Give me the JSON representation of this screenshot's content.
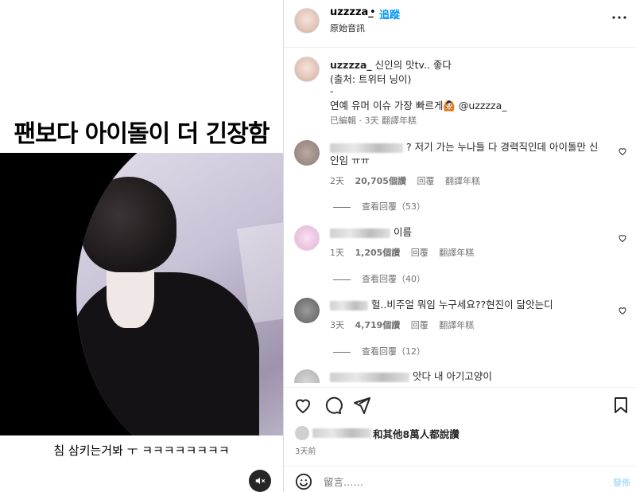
{
  "media": {
    "caption_top": "팬보다 아이돌이 더 긴장함",
    "caption_bottom": "침 삼키는거봐 ㅜ ㅋㅋㅋㅋㅋㅋㅋㅋ",
    "mute_icon": "speaker-muted-icon"
  },
  "header": {
    "username": "uzzzza_",
    "dot": "•",
    "follow_label": "追蹤",
    "audio_label": "原始音訊",
    "more_icon": "more-horizontal-icon"
  },
  "caption": {
    "username": "uzzzza_",
    "line1": "신인의 맛tv.. 좋다",
    "line2": "(출처: 트위터 닝이)",
    "line3": "-",
    "line4": "연예 유머 이슈 가장 빠르게🙆🏻 @uzzzza_",
    "meta": "已編輯 · 3天    翻譯年糕"
  },
  "comments": [
    {
      "text": "? 저기 가는 누나들 다 경력직인데 아이돌만 신인임 ㅠㅠ",
      "time": "2天",
      "likes": "20,705個讚",
      "reply_label": "回覆",
      "translate_label": "翻譯年糕",
      "replies": "查看回覆（53）"
    },
    {
      "text": "이름",
      "time": "1天",
      "likes": "1,205個讚",
      "reply_label": "回覆",
      "translate_label": "翻譯年糕",
      "replies": "查看回覆（40）"
    },
    {
      "text": "헐..비주얼 뭐임 누구세요??현진이 닮앗는디",
      "time": "3天",
      "likes": "4,719個讚",
      "reply_label": "回覆",
      "translate_label": "翻譯年糕",
      "replies": "查看回覆（12）"
    },
    {
      "text": "앗다 내 아기고양이"
    }
  ],
  "actions": {
    "like_icon": "heart-icon",
    "comment_icon": "comment-icon",
    "share_icon": "send-icon",
    "save_icon": "bookmark-icon"
  },
  "likes_text": "和其他8萬人都說讚",
  "time_ago": "3天前",
  "comment_box": {
    "placeholder": "留言……",
    "post_label": "發佈",
    "emoji_icon": "emoji-icon"
  }
}
